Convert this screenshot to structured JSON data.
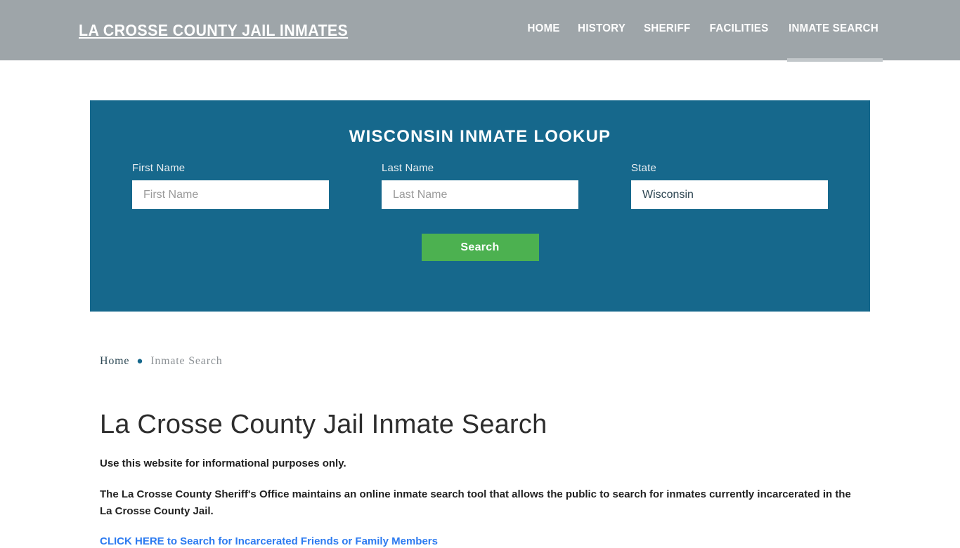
{
  "header": {
    "brand": "LA CROSSE COUNTY JAIL INMATES",
    "nav": [
      {
        "label": "HOME",
        "active": false
      },
      {
        "label": "HISTORY",
        "active": false
      },
      {
        "label": "SHERIFF",
        "active": false
      },
      {
        "label": "FACILITIES",
        "active": false
      },
      {
        "label": "INMATE SEARCH",
        "active": true
      }
    ],
    "background_color": "#9ea5a9",
    "active_underline_color": "#c2c7ca"
  },
  "lookup": {
    "title": "WISCONSIN INMATE LOOKUP",
    "panel_color": "#16688c",
    "fields": {
      "first": {
        "label": "First Name",
        "placeholder": "First Name",
        "value": ""
      },
      "last": {
        "label": "Last Name",
        "placeholder": "Last Name",
        "value": ""
      },
      "state": {
        "label": "State",
        "placeholder": "State",
        "value": "Wisconsin"
      }
    },
    "submit": {
      "label": "Search",
      "color": "#4cb150"
    }
  },
  "breadcrumb": {
    "home": "Home",
    "separator": "●",
    "current": "Inmate Search"
  },
  "main": {
    "title": "La Crosse County Jail Inmate Search",
    "paragraph1": "Use this website for informational purposes only.",
    "paragraph2": "The La Crosse County Sheriff's Office maintains an online inmate search tool that allows the public to search for inmates currently incarcerated in the La Crosse County Jail.",
    "cta_link": "CLICK HERE to Search for Incarcerated Friends or Family Members",
    "link_color": "#2d7bf0"
  }
}
